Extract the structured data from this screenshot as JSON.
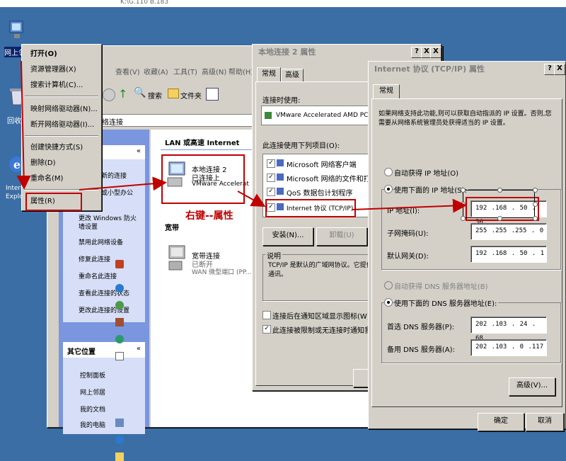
{
  "colors": {
    "desktop": "#3a6ea5",
    "accent": "#c00000",
    "arrow": "#c00000",
    "listsel": "#0a246a"
  },
  "top_fragment": "K:\\G.110 B.183",
  "desktop_icons": [
    {
      "label": "网上邻",
      "icon": "network-neighborhood-icon"
    },
    {
      "label": "回收",
      "icon": "recycle-bin-icon"
    },
    {
      "label": "Intern Explo",
      "icon": "ie-icon"
    }
  ],
  "explorer": {
    "menubar": [
      "查看(V)",
      "收藏(A)",
      "工具(T)",
      "高级(N)",
      "帮助(H)"
    ],
    "toolbar": {
      "search": "搜索",
      "folders": "文件夹"
    },
    "address": "络连接",
    "tasks_header": "",
    "tasks": [
      "新的连接",
      "或小型办公",
      "更改 Windows 防火墙设置",
      "禁用此网络设备",
      "修复此连接",
      "重命名此连接",
      "查看此连接的状态",
      "更改此连接的设置"
    ],
    "other_header": "其它位置",
    "other": [
      "控制面板",
      "网上邻居",
      "我的文档",
      "我的电脑"
    ],
    "section_lan": "LAN 或高速 Internet",
    "conn1": {
      "name": "本地连接 2",
      "status": "已连接上",
      "device": "VMware Accelerat"
    },
    "section_broadband": "宽带",
    "conn2": {
      "name": "宽带连接",
      "status": "已断开",
      "device": "WAN 微型端口 (PP..."
    }
  },
  "context_menu": [
    "打开(O)",
    "资源管理器(X)",
    "搜索计算机(C)...",
    "映射网络驱动器(N)...",
    "断开网络驱动器(I)...",
    "创建快捷方式(S)",
    "删除(D)",
    "重命名(M)",
    "属性(R)"
  ],
  "annotation": "右键--属性",
  "props": {
    "title": "本地连接 2 属性",
    "tabs": [
      "常规",
      "高级"
    ],
    "connect_using": "连接时使用:",
    "adapter": "VMware Accelerated AMD PCNet A",
    "items_label": "此连接使用下列项目(O):",
    "items": [
      {
        "label": "Microsoft 网络客户端",
        "checked": true
      },
      {
        "label": "Microsoft 网络的文件和打印机共",
        "checked": true
      },
      {
        "label": "QoS 数据包计划程序",
        "checked": true
      },
      {
        "label": "Internet 协议 (TCP/IP)",
        "checked": true
      }
    ],
    "install": "安装(N)...",
    "uninstall": "卸载(U)",
    "desc_label": "说明",
    "desc": "TCP/IP 是默认的广域网协议。它提供跨越多种互联网络的通讯。",
    "cb1": "连接后在通知区域显示图标(W)",
    "cb2": "此连接被限制或无连接时通知我(M)",
    "ok": "确"
  },
  "tcpip": {
    "title": "Internet 协议 (TCP/IP) 属性",
    "tab": "常规",
    "intro": "如果网络支持此功能,则可以获取自动指派的 IP 设置。否则,您需要从网络系统管理员处获得适当的 IP 设置。",
    "auto_ip": "自动获得 IP 地址(O)",
    "manual_ip": "使用下面的 IP 地址(S):",
    "ip_label": "IP 地址(I):",
    "ip": "192 .168 . 50 . 56",
    "mask_label": "子网掩码(U):",
    "mask": "255 .255 .255 . 0",
    "gw_label": "默认网关(D):",
    "gw": "192 .168 . 50 . 1",
    "auto_dns": "自动获得 DNS 服务器地址(B)",
    "manual_dns": "使用下面的 DNS 服务器地址(E):",
    "dns1_label": "首选 DNS 服务器(P):",
    "dns1": "202 .103 . 24 . 68",
    "dns2_label": "备用 DNS 服务器(A):",
    "dns2": "202 .103 . 0 .117",
    "advanced": "高级(V)...",
    "ok": "确定",
    "cancel": "取消"
  },
  "title_buttons": {
    "help": "?",
    "close": "X"
  }
}
